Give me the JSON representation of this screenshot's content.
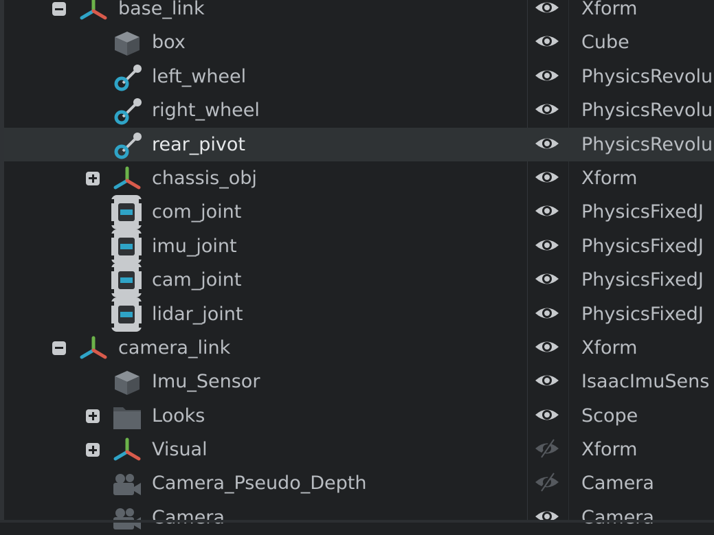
{
  "stage_tree": {
    "rows": [
      {
        "name": "base_link",
        "type": "Xform",
        "icon": "xform-axis-icon",
        "expander": "minus",
        "depth": 1,
        "visible": true
      },
      {
        "name": "box",
        "type": "Cube",
        "icon": "cube-icon",
        "expander": "none",
        "depth": 2,
        "visible": true
      },
      {
        "name": "left_wheel",
        "type": "PhysicsRevolu",
        "icon": "revolute-joint-icon",
        "expander": "none",
        "depth": 2,
        "visible": true
      },
      {
        "name": "right_wheel",
        "type": "PhysicsRevolu",
        "icon": "revolute-joint-icon",
        "expander": "none",
        "depth": 2,
        "visible": true
      },
      {
        "name": "rear_pivot",
        "type": "PhysicsRevolu",
        "icon": "revolute-joint-icon",
        "expander": "none",
        "depth": 2,
        "visible": true,
        "selected": true
      },
      {
        "name": "chassis_obj",
        "type": "Xform",
        "icon": "xform-axis-icon",
        "expander": "plus",
        "depth": 2,
        "visible": true
      },
      {
        "name": "com_joint",
        "type": "PhysicsFixedJ",
        "icon": "fixed-joint-icon",
        "expander": "none",
        "depth": 2,
        "visible": true
      },
      {
        "name": "imu_joint",
        "type": "PhysicsFixedJ",
        "icon": "fixed-joint-icon",
        "expander": "none",
        "depth": 2,
        "visible": true
      },
      {
        "name": "cam_joint",
        "type": "PhysicsFixedJ",
        "icon": "fixed-joint-icon",
        "expander": "none",
        "depth": 2,
        "visible": true
      },
      {
        "name": "lidar_joint",
        "type": "PhysicsFixedJ",
        "icon": "fixed-joint-icon",
        "expander": "none",
        "depth": 2,
        "visible": true
      },
      {
        "name": "camera_link",
        "type": "Xform",
        "icon": "xform-axis-icon",
        "expander": "minus",
        "depth": 1,
        "visible": true
      },
      {
        "name": "Imu_Sensor",
        "type": "IsaacImuSens",
        "icon": "cube-icon",
        "expander": "none",
        "depth": 2,
        "visible": true
      },
      {
        "name": "Looks",
        "type": "Scope",
        "icon": "folder-icon",
        "expander": "plus",
        "depth": 2,
        "visible": true
      },
      {
        "name": "Visual",
        "type": "Xform",
        "icon": "xform-axis-icon",
        "expander": "plus",
        "depth": 2,
        "visible": false
      },
      {
        "name": "Camera_Pseudo_Depth",
        "type": "Camera",
        "icon": "camera-icon",
        "expander": "none",
        "depth": 2,
        "visible": false
      },
      {
        "name": "Camera",
        "type": "Camera",
        "icon": "camera-icon",
        "expander": "none",
        "depth": 2,
        "visible": true
      }
    ]
  },
  "colors": {
    "background": "#1f2123",
    "selected_row": "#2f3335",
    "text": "#b9bdc2",
    "accent_cyan": "#2fa4c7",
    "accent_red": "#d95b4c",
    "accent_green": "#6cb34a"
  }
}
